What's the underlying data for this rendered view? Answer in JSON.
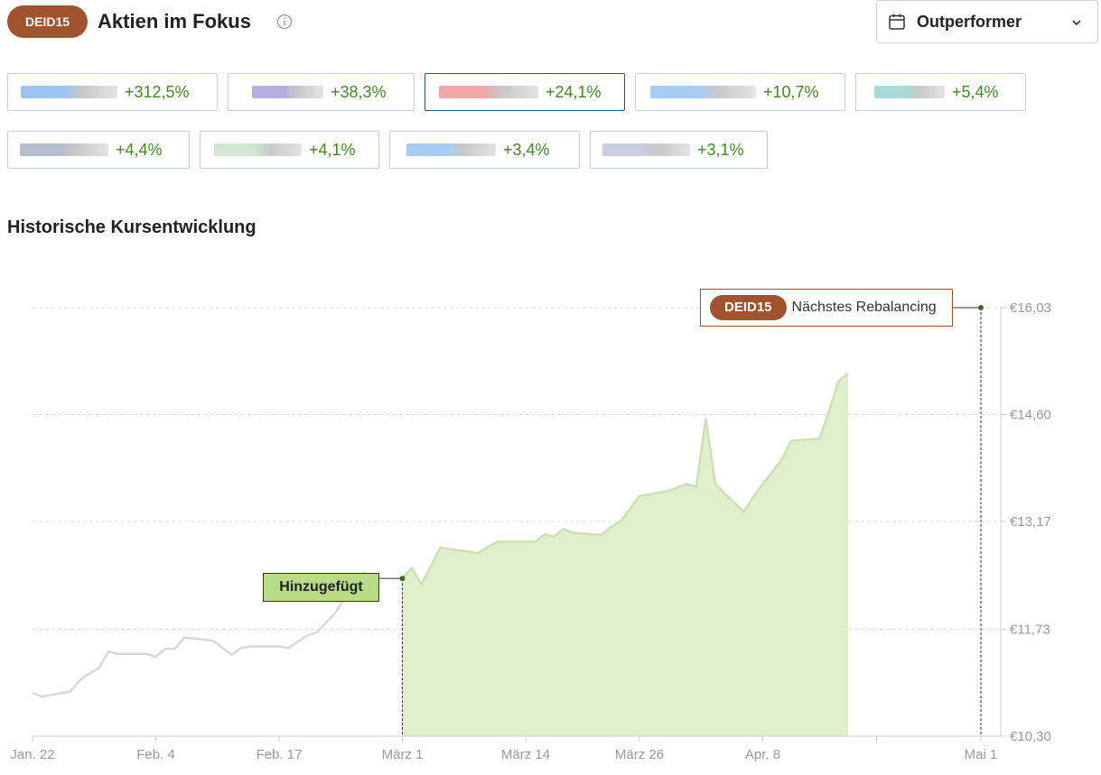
{
  "header": {
    "badge": "DEID15",
    "title": "Aktien im Fokus",
    "info_icon": "info-icon"
  },
  "filter": {
    "icon": "calendar-icon",
    "label": "Outperformer",
    "chevron_icon": "chevron-down-icon"
  },
  "performers": [
    {
      "change": "+312,5%",
      "logo_color": "#9cc4f0",
      "selected": false
    },
    {
      "change": "+38,3%",
      "logo_color": "#b5aee0",
      "selected": false
    },
    {
      "change": "+24,1%",
      "logo_color": "#f0a8a8",
      "selected": true
    },
    {
      "change": "+10,7%",
      "logo_color": "#a8cdf2",
      "selected": false
    },
    {
      "change": "+5,4%",
      "logo_color": "#a9dad6",
      "selected": false
    },
    {
      "change": "+4,4%",
      "logo_color": "#b4bdcc",
      "selected": false
    },
    {
      "change": "+4,1%",
      "logo_color": "#cfe8cf",
      "selected": false
    },
    {
      "change": "+3,4%",
      "logo_color": "#a8cdf2",
      "selected": false
    },
    {
      "change": "+3,1%",
      "logo_color": "#c8cde0",
      "selected": false
    }
  ],
  "section_title": "Historische Kursentwicklung",
  "colors": {
    "accent": "#a0532d",
    "positive": "#3f8a1e",
    "area_fill": "#e0f0cc",
    "area_line": "#cbe0b4",
    "pre_line": "#d8d8d8",
    "added_box": "#b8dc85"
  },
  "chart_data": {
    "type": "area",
    "title": "Historische Kursentwicklung",
    "xlabel": "",
    "ylabel": "",
    "currency": "€",
    "ylim": [
      10.3,
      16.03
    ],
    "yticks": [
      "€10,30",
      "€11,73",
      "€13,17",
      "€14,60",
      "€16,03"
    ],
    "ytick_values": [
      10.3,
      11.73,
      13.17,
      14.6,
      16.03
    ],
    "x_range": [
      "2024-01-22",
      "2024-05-01"
    ],
    "xticks": [
      {
        "label": "Jan. 22",
        "date": "2024-01-22"
      },
      {
        "label": "Feb. 4",
        "date": "2024-02-04"
      },
      {
        "label": "Feb. 17",
        "date": "2024-02-17"
      },
      {
        "label": "März 1",
        "date": "2024-03-01"
      },
      {
        "label": "März 14",
        "date": "2024-03-14"
      },
      {
        "label": "März 26",
        "date": "2024-03-26"
      },
      {
        "label": "Apr. 8",
        "date": "2024-04-08"
      },
      {
        "label": "Mai 1",
        "date": "2024-05-01"
      }
    ],
    "grid": true,
    "series": [
      {
        "role": "before-added",
        "points": [
          [
            "2024-01-22",
            10.88
          ],
          [
            "2024-01-23",
            10.83
          ],
          [
            "2024-01-26",
            10.9
          ],
          [
            "2024-01-27",
            11.05
          ],
          [
            "2024-01-28",
            11.14
          ],
          [
            "2024-01-29",
            11.21
          ],
          [
            "2024-01-30",
            11.43
          ],
          [
            "2024-01-31",
            11.4
          ],
          [
            "2024-02-03",
            11.4
          ],
          [
            "2024-02-04",
            11.36
          ],
          [
            "2024-02-05",
            11.47
          ],
          [
            "2024-02-06",
            11.47
          ],
          [
            "2024-02-07",
            11.62
          ],
          [
            "2024-02-10",
            11.58
          ],
          [
            "2024-02-12",
            11.39
          ],
          [
            "2024-02-13",
            11.48
          ],
          [
            "2024-02-14",
            11.5
          ],
          [
            "2024-02-17",
            11.5
          ],
          [
            "2024-02-18",
            11.48
          ],
          [
            "2024-02-20",
            11.65
          ],
          [
            "2024-02-21",
            11.69
          ],
          [
            "2024-02-23",
            11.96
          ],
          [
            "2024-02-24",
            12.17
          ],
          [
            "2024-02-25",
            12.18
          ],
          [
            "2024-02-26",
            12.5
          ]
        ]
      },
      {
        "role": "after-added",
        "points": [
          [
            "2024-03-01",
            12.41
          ],
          [
            "2024-03-02",
            12.55
          ],
          [
            "2024-03-03",
            12.33
          ],
          [
            "2024-03-05",
            12.82
          ],
          [
            "2024-03-09",
            12.75
          ],
          [
            "2024-03-10",
            12.83
          ],
          [
            "2024-03-11",
            12.9
          ],
          [
            "2024-03-14",
            12.9
          ],
          [
            "2024-03-15",
            12.9
          ],
          [
            "2024-03-16",
            13.0
          ],
          [
            "2024-03-17",
            12.97
          ],
          [
            "2024-03-18",
            13.07
          ],
          [
            "2024-03-19",
            13.02
          ],
          [
            "2024-03-22",
            12.99
          ],
          [
            "2024-03-23",
            13.1
          ],
          [
            "2024-03-24",
            13.17
          ],
          [
            "2024-03-26",
            13.51
          ],
          [
            "2024-03-29",
            13.58
          ],
          [
            "2024-03-31",
            13.67
          ],
          [
            "2024-04-01",
            13.64
          ],
          [
            "2024-04-02",
            14.55
          ],
          [
            "2024-04-03",
            13.67
          ],
          [
            "2024-04-06",
            13.3
          ],
          [
            "2024-04-07",
            13.5
          ],
          [
            "2024-04-08",
            13.67
          ],
          [
            "2024-04-10",
            14.0
          ],
          [
            "2024-04-11",
            14.25
          ],
          [
            "2024-04-14",
            14.28
          ],
          [
            "2024-04-15",
            14.65
          ],
          [
            "2024-04-16",
            15.05
          ],
          [
            "2024-04-17",
            15.15
          ]
        ]
      }
    ],
    "annotations": [
      {
        "label": "Hinzugefügt",
        "date": "2024-03-01",
        "value": 12.41
      },
      {
        "badge": "DEID15",
        "label": "Nächstes Rebalancing",
        "date": "2024-05-01",
        "value": 16.03
      }
    ]
  }
}
